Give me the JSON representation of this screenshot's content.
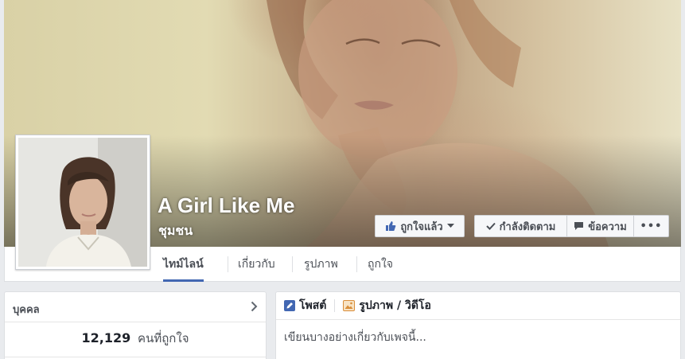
{
  "page": {
    "name": "A Girl Like Me",
    "category": "ชุมชน"
  },
  "actions": {
    "like_label": "ถูกใจแล้ว",
    "follow_label": "กำลังติดตาม",
    "message_label": "ข้อความ",
    "more_label": "•••"
  },
  "nav": {
    "tabs": [
      {
        "label": "ไทม์ไลน์",
        "active": true
      },
      {
        "label": "เกี่ยวกับ",
        "active": false
      },
      {
        "label": "รูปภาพ",
        "active": false
      },
      {
        "label": "ถูกใจ",
        "active": false
      }
    ]
  },
  "people": {
    "title": "บุคคล",
    "likes_count": "12,129",
    "likes_label": "คนที่ถูกใจ"
  },
  "composer": {
    "tabs": [
      {
        "label": "โพสต์",
        "icon": "pencil-icon"
      },
      {
        "label": "รูปภาพ / วิดีโอ",
        "icon": "photo-icon"
      }
    ],
    "placeholder": "เขียนบางอย่างเกี่ยวกับเพจนี้..."
  },
  "colors": {
    "accent": "#4267b2",
    "background": "#e9ebee"
  }
}
